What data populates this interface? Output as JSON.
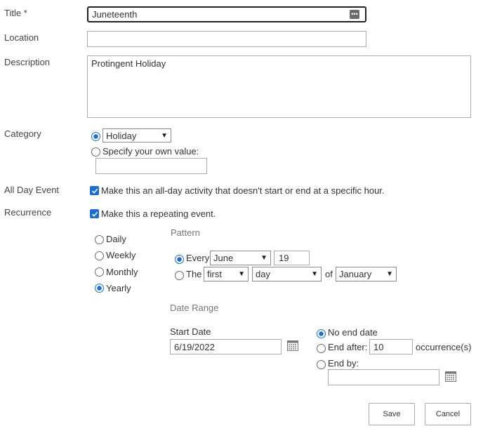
{
  "form": {
    "title_label": "Title *",
    "title_value": "Juneteenth",
    "location_label": "Location",
    "location_value": "",
    "description_label": "Description",
    "description_value": "Protingent Holiday",
    "category_label": "Category",
    "category_selected": "Holiday",
    "category_own_label": "Specify your own value:",
    "category_own_value": "",
    "allday_label": "All Day Event",
    "allday_text": "Make this an all-day activity that doesn't start or end at a specific hour.",
    "recurrence_label": "Recurrence",
    "recurrence_text": "Make this a repeating event."
  },
  "recurrence": {
    "frequency_options": [
      "Daily",
      "Weekly",
      "Monthly",
      "Yearly"
    ],
    "frequency_selected": "Yearly",
    "pattern_label": "Pattern",
    "every_label": "Every",
    "every_month": "June",
    "every_day": "19",
    "the_label": "The",
    "the_ordinal": "first",
    "the_day": "day",
    "of_label": "of",
    "the_month": "January",
    "date_range_label": "Date Range",
    "start_date_label": "Start Date",
    "start_date_value": "6/19/2022",
    "no_end_label": "No end date",
    "end_after_label": "End after:",
    "end_after_value": "10",
    "occurrences_label": "occurrence(s)",
    "end_by_label": "End by:",
    "end_by_value": ""
  },
  "buttons": {
    "save": "Save",
    "cancel": "Cancel"
  },
  "colors": {
    "accent": "#1a6fd6",
    "border": "#ababab"
  }
}
